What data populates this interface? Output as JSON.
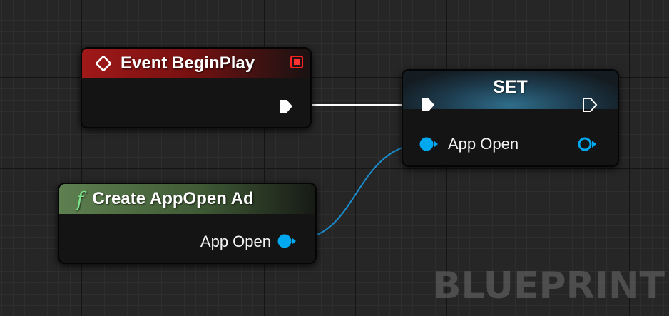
{
  "nodes": {
    "event_begin_play": {
      "title": "Event BeginPlay"
    },
    "create_app_open_ad": {
      "icon": "function-icon",
      "icon_glyph": "f",
      "title": "Create AppOpen Ad",
      "output_pin_label": "App Open"
    },
    "set": {
      "title": "SET",
      "input_pin_label": "App Open"
    }
  },
  "colors": {
    "event_header": "#a01919",
    "function_header": "#5e8050",
    "set_header": "#2f6d8a",
    "exec_pin": "#ffffff",
    "object_pin": "#00a8f0",
    "stop_icon": "#ff2222"
  },
  "watermark": "BLUEPRINT"
}
